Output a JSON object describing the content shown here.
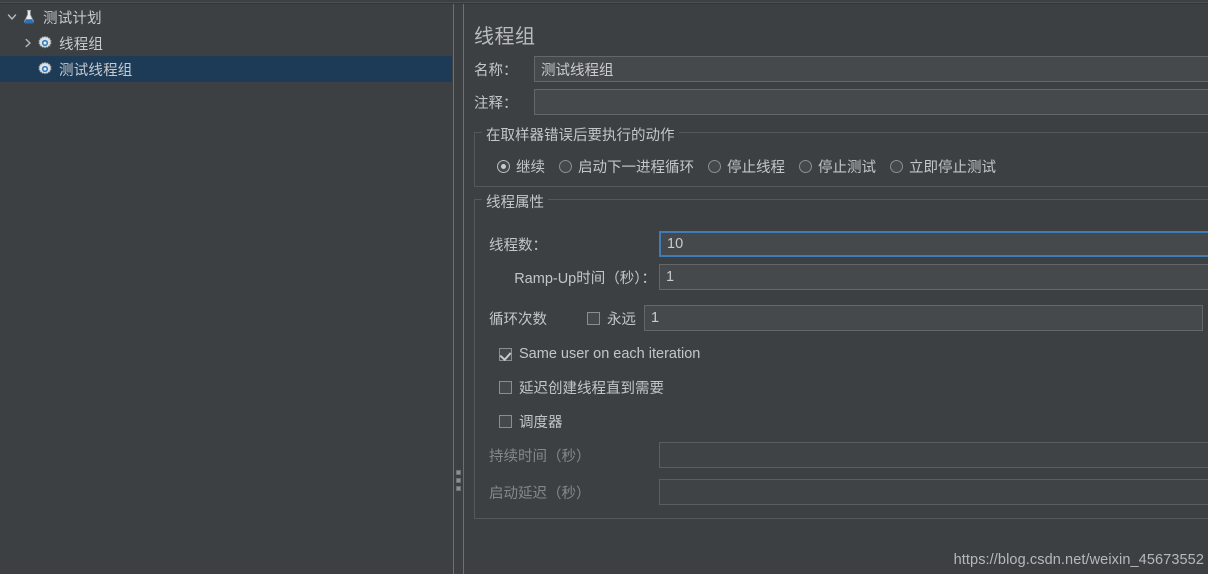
{
  "tree": {
    "items": [
      {
        "label": "测试计划",
        "icon": "flask-icon",
        "expanded": true,
        "twisty": "chevron-down-icon",
        "depth": 0,
        "selected": false
      },
      {
        "label": "线程组",
        "icon": "gear-icon",
        "expanded": false,
        "twisty": "chevron-right-icon",
        "depth": 1,
        "selected": false
      },
      {
        "label": "测试线程组",
        "icon": "gear-icon",
        "expanded": null,
        "twisty": "none",
        "depth": 2,
        "selected": true
      }
    ]
  },
  "detail": {
    "title": "线程组",
    "name": {
      "label": "名称：",
      "value": "测试线程组"
    },
    "comment": {
      "label": "注释：",
      "value": ""
    },
    "on_error": {
      "legend": "在取样器错误后要执行的动作",
      "options": [
        {
          "label": "继续",
          "selected": true
        },
        {
          "label": "启动下一进程循环",
          "selected": false
        },
        {
          "label": "停止线程",
          "selected": false
        },
        {
          "label": "停止测试",
          "selected": false
        },
        {
          "label": "立即停止测试",
          "selected": false
        }
      ]
    },
    "thread_props": {
      "legend": "线程属性",
      "num_threads": {
        "label": "线程数：",
        "value": "10",
        "focused": true
      },
      "ramp_up": {
        "label": "Ramp-Up时间（秒）：",
        "value": "1",
        "focused": false
      },
      "loop_count": {
        "label": "循环次数",
        "forever_label": "永远",
        "forever_checked": false,
        "value": "1"
      },
      "same_user": {
        "label": "Same user on each iteration",
        "checked": true
      },
      "delay_create": {
        "label": "延迟创建线程直到需要",
        "checked": false
      },
      "scheduler": {
        "label": "调度器",
        "checked": false
      },
      "duration": {
        "label": "持续时间（秒）",
        "value": "",
        "disabled": true
      },
      "startup_delay": {
        "label": "启动延迟（秒）",
        "value": "",
        "disabled": true
      }
    }
  },
  "watermark": {
    "text": "https://blog.csdn.net/weixin_45673552"
  },
  "colors": {
    "background": "#3c4043",
    "field_background": "#45494c",
    "selection": "#1d3b56",
    "focus_border": "#3f7cb6",
    "text": "#c3c6c9",
    "text_dim": "#84888c"
  }
}
